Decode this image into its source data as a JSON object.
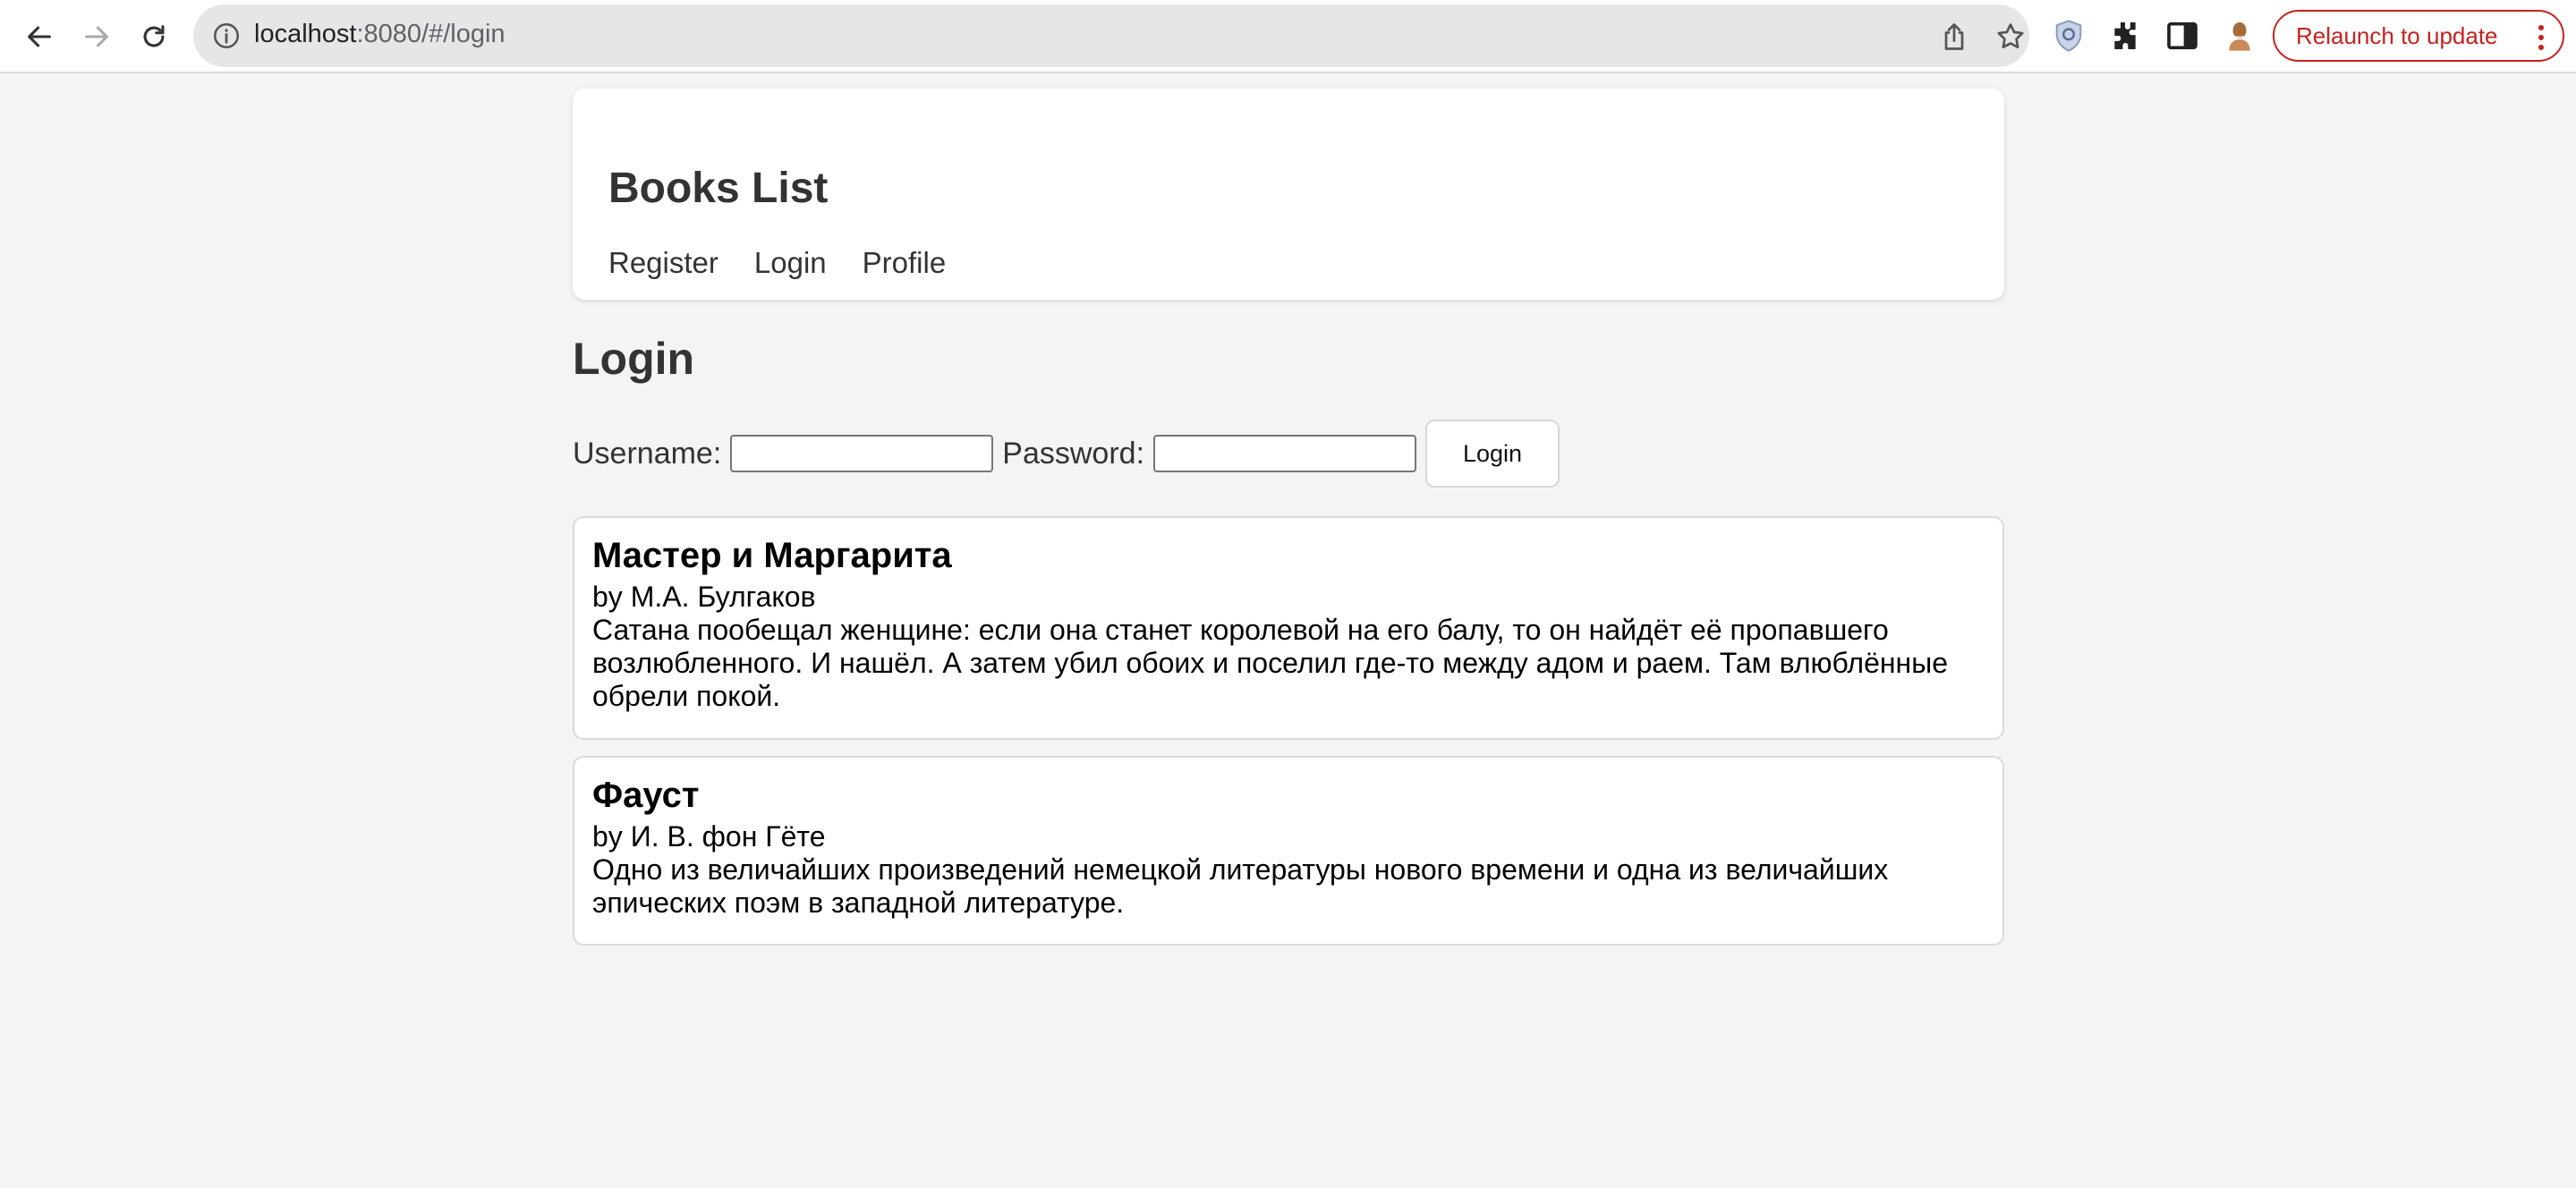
{
  "browser": {
    "url_host": "localhost",
    "url_rest": ":8080/#/login",
    "relaunch_label": "Relaunch to update"
  },
  "site": {
    "title": "Books List",
    "nav": [
      "Register",
      "Login",
      "Profile"
    ]
  },
  "login": {
    "heading": "Login",
    "username_label": "Username:",
    "username_value": "",
    "password_label": "Password:",
    "password_value": "",
    "submit_label": "Login"
  },
  "books": [
    {
      "title": "Мастер и Маргарита",
      "author": "by М.А. Булгаков",
      "description": "Сатана пообещал женщине: если она станет королевой на его балу, то он найдёт её пропавшего возлюбленного. И нашёл. А затем убил обоих и поселил где-то между адом и раем. Там влюблённые обрели покой."
    },
    {
      "title": "Фауст",
      "author": "by И. В. фон Гёте",
      "description": "Одно из величайших произведений немецкой литературы нового времени и одна из величайших эпических поэм в западной литературе."
    }
  ],
  "colors": {
    "page_background": "#f4f4f4",
    "relaunch_accent": "#c5221f"
  }
}
